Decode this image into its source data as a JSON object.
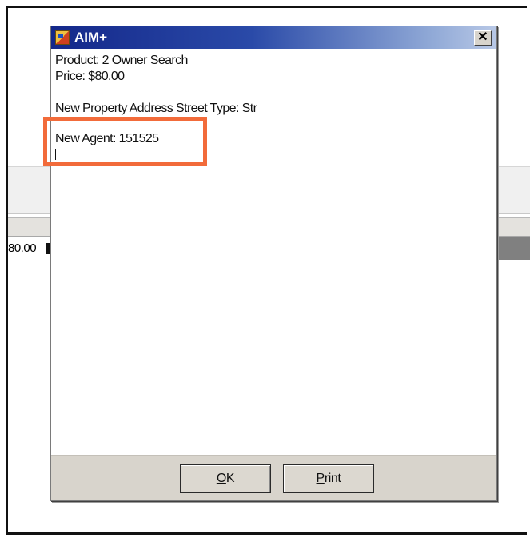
{
  "background": {
    "cell_value": "80.00"
  },
  "dialog": {
    "title": "AIM+",
    "close_symbol": "✕",
    "icon": "app-icon",
    "lines": {
      "product": "Product: 2 Owner Search",
      "price": "Price: $80.00",
      "street_type": "New Property Address Street Type: Str",
      "agent": "New Agent: 151525"
    },
    "buttons": {
      "ok": {
        "accel": "O",
        "rest": "K"
      },
      "print": {
        "accel": "P",
        "rest": "rint"
      }
    }
  },
  "colors": {
    "highlight": "#f26b3a",
    "titlebar": "#14288a"
  }
}
